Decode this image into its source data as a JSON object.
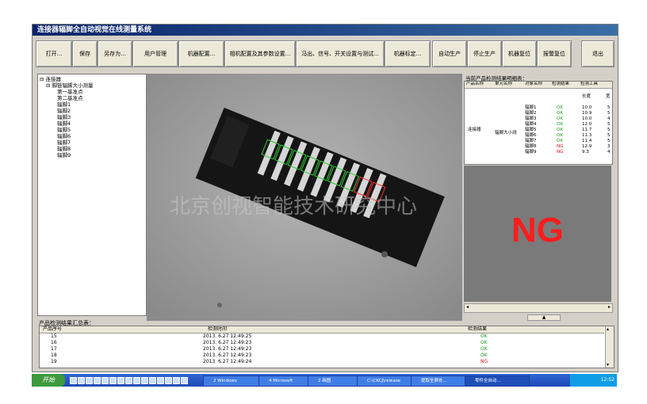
{
  "window": {
    "title": "连接器辐脚全自动视觉在线测量系统"
  },
  "toolbar": {
    "buttons": [
      "打开...",
      "保存",
      "另存为...",
      "用户管理",
      "机器配置...",
      "相机配置及其参数设置...",
      "冯出、信号、开关设置与测试...",
      "机器标定...",
      "自动生产",
      "停止生产",
      "机器复位",
      "报警复位",
      "退出"
    ]
  },
  "tree": {
    "root": "连接器",
    "group": "脚链辐脚大小测量",
    "items": [
      "第一基准点",
      "第二基准点",
      "辐脚1",
      "辐脚2",
      "辐脚3",
      "辐脚4",
      "辐脚5",
      "辐脚6",
      "辐脚7",
      "辐脚8",
      "辐脚9"
    ]
  },
  "result_panel": {
    "title": "当前产品检测结果明细表：",
    "headers": [
      "产品名称",
      "单元名称",
      "对象名称",
      "检测结果",
      "检测工具"
    ],
    "subheaders": [
      "长度",
      "宽"
    ],
    "product": "连接器",
    "unit": "辐脚大小测",
    "rows": [
      {
        "name": "辐脚1",
        "result": "OK",
        "length": "10.0",
        "extra": "5"
      },
      {
        "name": "辐脚2",
        "result": "OK",
        "length": "10.9",
        "extra": "5"
      },
      {
        "name": "辐脚3",
        "result": "OK",
        "length": "10.0",
        "extra": "4"
      },
      {
        "name": "辐脚4",
        "result": "OK",
        "length": "12.0",
        "extra": "5"
      },
      {
        "name": "辐脚5",
        "result": "OK",
        "length": "11.7",
        "extra": "5"
      },
      {
        "name": "辐脚6",
        "result": "OK",
        "length": "11.3",
        "extra": "5"
      },
      {
        "name": "辐脚7",
        "result": "OK",
        "length": "11.4",
        "extra": "5"
      },
      {
        "name": "辐脚8",
        "result": "NG",
        "length": "12.9",
        "extra": "3"
      },
      {
        "name": "辐脚9",
        "result": "NG",
        "length": "9.3",
        "extra": "4"
      }
    ],
    "status": "NG",
    "status_color": "#ff1c1c"
  },
  "summary": {
    "title": "产品检测结果汇总表：",
    "headers": [
      "产品序号",
      "检测时间",
      "检测结果"
    ],
    "rows": [
      {
        "id": "15",
        "time": "2013. 6.27 12:49:25",
        "result": "OK"
      },
      {
        "id": "16",
        "time": "2013. 6.27 12:49:23",
        "result": "OK"
      },
      {
        "id": "17",
        "time": "2013. 6.27 12:49:23",
        "result": "OK"
      },
      {
        "id": "18",
        "time": "2013. 6.27 12:49:23",
        "result": "OK"
      },
      {
        "id": "19",
        "time": "2013. 6.27 12:49:24",
        "result": "NG"
      }
    ]
  },
  "taskbar": {
    "start": "开始",
    "tasks": [
      "2 Windows",
      "4 Microsoft",
      "2 画图",
      "C:\\CKCJ\\release",
      "提取全屏处...",
      "零件全自动..."
    ],
    "clock": "12:52"
  },
  "watermark": "北京创视智能技术研究中心"
}
